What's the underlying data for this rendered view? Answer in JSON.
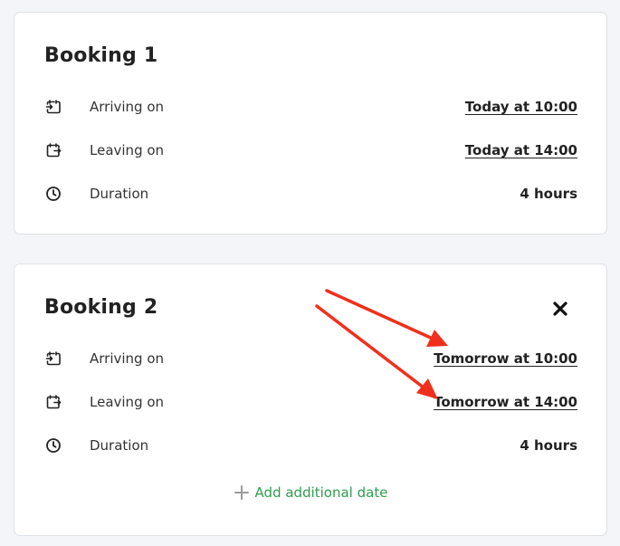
{
  "bookings": [
    {
      "title": "Booking 1",
      "arriving_label": "Arriving on",
      "arriving_value": "Today at 10:00",
      "leaving_label": "Leaving on",
      "leaving_value": "Today at 14:00",
      "duration_label": "Duration",
      "duration_value": "4 hours"
    },
    {
      "title": "Booking 2",
      "arriving_label": "Arriving on",
      "arriving_value": "Tomorrow at 10:00",
      "leaving_label": "Leaving on",
      "leaving_value": "Tomorrow at 14:00",
      "duration_label": "Duration",
      "duration_value": "4 hours",
      "add_date_label": "Add additional date"
    }
  ],
  "icons": {
    "arriving": "calendar-arrive-icon",
    "leaving": "calendar-leave-icon",
    "duration": "clock-icon",
    "close": "close-icon",
    "add": "plus-icon"
  },
  "colors": {
    "accent_green": "#2e9e4f",
    "annotation_red": "#f0301c"
  }
}
